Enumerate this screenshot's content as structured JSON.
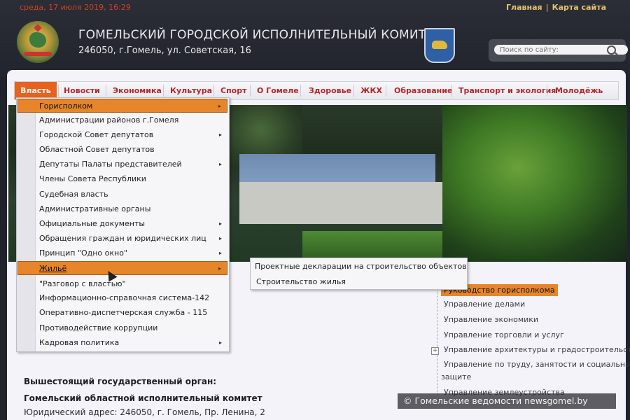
{
  "header": {
    "datetime": "среда, 17 июля 2019, 16:29",
    "links": [
      "Главная",
      "Карта сайта"
    ],
    "title": "ГОМЕЛЬСКИЙ ГОРОДСКОЙ ИСПОЛНИТЕЛЬНЫЙ КОМИТЕТ",
    "address": "246050, г.Гомель, ул. Советская, 16"
  },
  "search": {
    "placeholder": "Поиск по сайту:"
  },
  "nav": {
    "items": [
      "Власть",
      "Новости",
      "Экономика",
      "Культура",
      "Спорт",
      "О Гомеле",
      "Здоровье",
      "ЖКХ",
      "Образование",
      "Транспорт и экология",
      "Молодёжь"
    ]
  },
  "dropdown": {
    "items": [
      {
        "label": "Горисполком",
        "arrow": "▸"
      },
      {
        "label": "Администрации районов г.Гомеля"
      },
      {
        "label": "Городской Совет депутатов",
        "arrow": "▸"
      },
      {
        "label": "Областной Совет депутатов"
      },
      {
        "label": "Депутаты Палаты представителей",
        "arrow": "▸"
      },
      {
        "label": "Члены Совета Республики"
      },
      {
        "label": "Судебная власть"
      },
      {
        "label": "Административные органы"
      },
      {
        "label": "Официальные документы",
        "arrow": "▸"
      },
      {
        "label": "Обращения граждан и юридических лиц",
        "arrow": "▸"
      },
      {
        "label": "Принцип \"Одно окно\"",
        "arrow": "▸"
      },
      {
        "label": "Жильё",
        "arrow": "▸"
      },
      {
        "label": "\"Разговор с властью\""
      },
      {
        "label": "Информационно-справочная система-142"
      },
      {
        "label": "Оперативно-диспетчерская служба - 115"
      },
      {
        "label": "Противодействие коррупции"
      },
      {
        "label": "Кадровая политика",
        "arrow": "▸"
      }
    ]
  },
  "submenu": {
    "items": [
      "Проектные декларации на строительство объектов",
      "Строительство жилья"
    ]
  },
  "sidebar": {
    "items": [
      "Руководство горисполкома",
      "Управление делами",
      "Управление экономики",
      "Управление торговли и услуг",
      "Управление архитектуры и градостроительства",
      "Управление по труду, занятости и социальной",
      "защите",
      "Управление землеустройства"
    ],
    "plus_symbol": "+"
  },
  "main": {
    "heading": "Вышестоящий государственный орган:",
    "org": "Гомельский областной исполнительный комитет",
    "address": "Юридический адрес: 246050, г. Гомель, Пр. Ленина, 2"
  },
  "watermark": {
    "text": "© Гомельские ведомости   newsgomel.by"
  },
  "colors": {
    "accent": "#e5621f",
    "nav_text": "#b3262a",
    "highlight": "#e6852a",
    "date": "#d0421f"
  }
}
